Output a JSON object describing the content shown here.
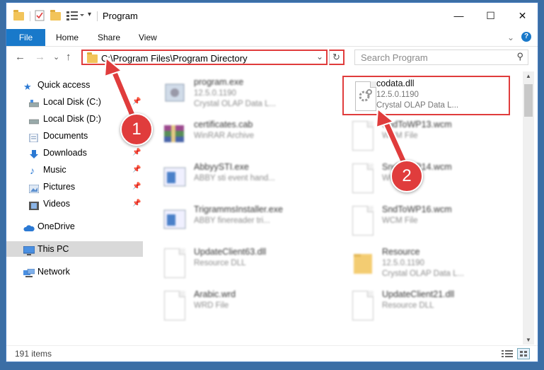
{
  "window": {
    "title": "Program"
  },
  "controls": {
    "minimize": "—",
    "maximize": "☐",
    "close": "✕"
  },
  "ribbon": {
    "tabs": [
      "File",
      "Home",
      "Share",
      "View"
    ],
    "expand": "⌄",
    "help": "?"
  },
  "nav": {
    "back": "←",
    "forward": "→",
    "recent": "⌄",
    "up": "↑",
    "address": "C:\\Program Files\\Program Directory",
    "address_dropdown": "⌄",
    "refresh": "↻",
    "search_placeholder": "Search Program",
    "search_icon": "⚲"
  },
  "sidebar": {
    "pin_icon": "📌",
    "items": [
      {
        "label": "Quick access",
        "icon": "star-icon"
      },
      {
        "label": "Local Disk (C:)",
        "icon": "drive-icon",
        "pinned": true
      },
      {
        "label": "Local Disk (D:)",
        "icon": "drive-icon"
      },
      {
        "label": "Documents",
        "icon": "documents-icon"
      },
      {
        "label": "Downloads",
        "icon": "downloads-icon",
        "pinned": true
      },
      {
        "label": "Music",
        "icon": "music-icon",
        "pinned": true
      },
      {
        "label": "Pictures",
        "icon": "pictures-icon",
        "pinned": true
      },
      {
        "label": "Videos",
        "icon": "videos-icon",
        "pinned": true
      },
      {
        "label": "OneDrive",
        "icon": "cloud-icon"
      },
      {
        "label": "This PC",
        "icon": "computer-icon",
        "selected": true
      },
      {
        "label": "Network",
        "icon": "network-icon"
      }
    ]
  },
  "files": [
    {
      "name": "program.exe",
      "l2": "12.5.0.1190",
      "l3": "Crystal OLAP Data L..."
    },
    {
      "name": "codata.dll",
      "l2": "12.5.0.1190",
      "l3": "Crystal OLAP Data L..."
    },
    {
      "name": "certificates.cab",
      "l2": "WinRAR Archive",
      "l3": ""
    },
    {
      "name": "SndToWP13.wcm",
      "l2": "WCM File",
      "l3": ""
    },
    {
      "name": "AbbyySTI.exe",
      "l2": "ABBY sti event hand...",
      "l3": ""
    },
    {
      "name": "SndToWP14.wcm",
      "l2": "WCM File",
      "l3": ""
    },
    {
      "name": "TrigrammsInstaller.exe",
      "l2": "ABBY finereader tri...",
      "l3": ""
    },
    {
      "name": "SndToWP16.wcm",
      "l2": "WCM File",
      "l3": ""
    },
    {
      "name": "UpdateClient63.dll",
      "l2": "Resource DLL",
      "l3": ""
    },
    {
      "name": "Resource",
      "l2": "12.5.0.1190",
      "l3": "Crystal OLAP Data L..."
    },
    {
      "name": "Arabic.wrd",
      "l2": "WRD File",
      "l3": ""
    },
    {
      "name": "UpdateClient21.dll",
      "l2": "Resource DLL",
      "l3": ""
    }
  ],
  "scrollbar": {
    "up": "▲",
    "down": "▼"
  },
  "status": {
    "count": "191 items"
  },
  "annotations": {
    "step1": "1",
    "step2": "2"
  },
  "colors": {
    "accent": "#1979ca",
    "highlight": "#e03c3c"
  }
}
